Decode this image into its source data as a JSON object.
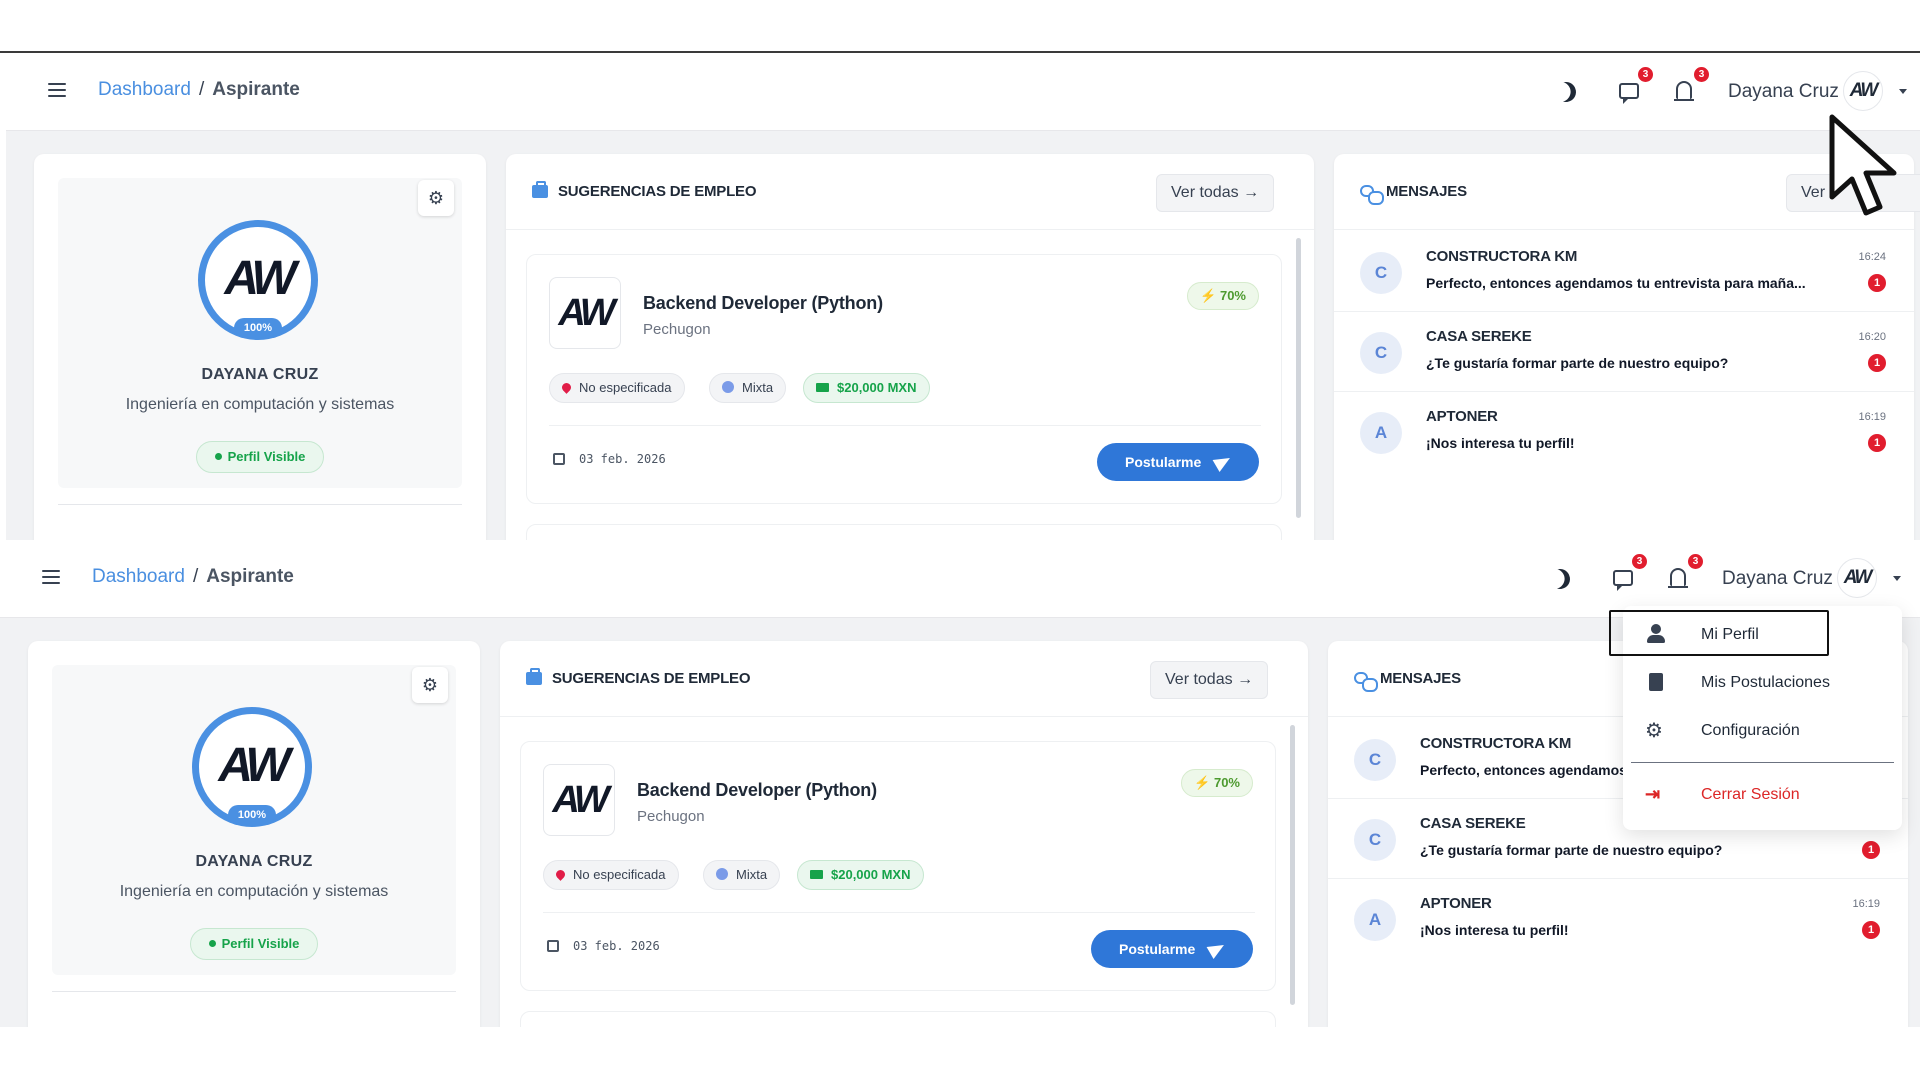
{
  "header": {
    "breadcrumb_link": "Dashboard",
    "breadcrumb_separator": "/",
    "breadcrumb_current": "Aspirante",
    "messages_badge": "3",
    "notifications_badge": "3",
    "user_name": "Dayana Cruz",
    "avatar_initials": "AW"
  },
  "profile": {
    "avatar_initials": "AW",
    "completion": "100%",
    "name": "DAYANA CRUZ",
    "career": "Ingeniería en computación y sistemas",
    "visibility": "Perfil Visible"
  },
  "jobs": {
    "title": "SUGERENCIAS DE EMPLEO",
    "view_all": "Ver todas",
    "items": [
      {
        "logo": "AW",
        "title": "Backend Developer (Python)",
        "company": "Pechugon",
        "match": "70%",
        "location": "No especificada",
        "modality": "Mixta",
        "salary": "$20,000 MXN",
        "date": "03 feb. 2026",
        "apply_label": "Postularme"
      }
    ]
  },
  "messages": {
    "title": "MENSAJES",
    "view_all_partial": "Ver t",
    "items": [
      {
        "initial": "C",
        "sender": "CONSTRUCTORA KM",
        "preview": "Perfecto, entonces agendamos tu entrevista para maña...",
        "time": "16:24",
        "unread": "1"
      },
      {
        "initial": "C",
        "sender": "CASA SEREKE",
        "preview": "¿Te gustaría formar parte de nuestro equipo?",
        "time": "16:20",
        "unread": "1"
      },
      {
        "initial": "A",
        "sender": "APTONER",
        "preview": "¡Nos interesa tu perfil!",
        "time": "16:19",
        "unread": "1"
      }
    ],
    "item0_preview_truncated": "Perfecto, entonces agendamos"
  },
  "user_menu": {
    "items": [
      {
        "label": "Mi Perfil",
        "icon": "user-icon"
      },
      {
        "label": "Mis Postulaciones",
        "icon": "file-icon"
      },
      {
        "label": "Configuración",
        "icon": "gear-icon"
      }
    ],
    "logout_label": "Cerrar Sesión",
    "logout_icon": "logout-icon"
  },
  "colors": {
    "accent": "#4a90e2",
    "primary_button": "#2f77d8",
    "badge": "#e11d2e",
    "success": "#16a34a",
    "logout": "#dc2626"
  }
}
